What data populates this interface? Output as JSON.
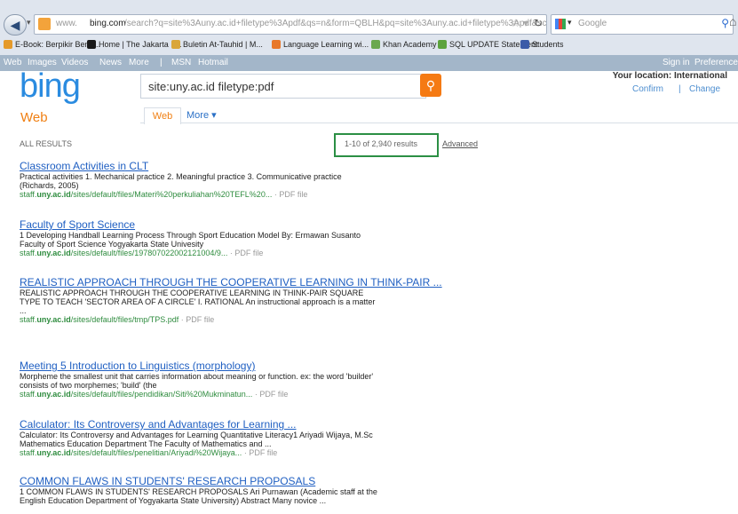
{
  "browser": {
    "url_prefix": "www.",
    "url_host": "bing.com",
    "url_path": "/search?q=site%3Auny.ac.id+filetype%3Apdf&qs=n&form=QBLH&pq=site%3Auny.ac.id+filetype%3Apdf&sc=0-",
    "search_engine_placeholder": "Google",
    "bookmarks": [
      {
        "label": "E-Book: Berpikir Bena...",
        "color": "#e59a2b"
      },
      {
        "label": "Home | The Jakarta P...",
        "color": "#1a1a1a"
      },
      {
        "label": "Buletin At-Tauhid | M...",
        "color": "#d9a63a"
      },
      {
        "label": "Language Learning wi...",
        "color": "#e8782a"
      },
      {
        "label": "Khan Academy",
        "color": "#6aa84f"
      },
      {
        "label": "SQL UPDATE Statement",
        "color": "#5ca33d"
      },
      {
        "label": "Students",
        "color": "#3b5ba8"
      }
    ]
  },
  "bing": {
    "nav_links": [
      "Web",
      "Images",
      "Videos",
      "News",
      "More",
      "|",
      "MSN",
      "Hotmail"
    ],
    "account_links": [
      "Sign in",
      "Preferences"
    ],
    "logo": "bing",
    "section_label": "Web",
    "search_query": "site:uny.ac.id filetype:pdf",
    "tabs": {
      "web": "Web",
      "more": "More ▾"
    },
    "location": "Your location: International",
    "confirm": "Confirm",
    "location_separator": "|",
    "change": "Change",
    "all_results": "ALL RESULTS",
    "result_count": "1-10 of 2,940 results",
    "advanced": "Advanced"
  },
  "results": [
    {
      "title": "Classroom Activities in CLT",
      "snippet": [
        "Practical activities 1. Mechanical practice 2. Meaningful practice 3. Communicative practice",
        "(Richards, 2005)"
      ],
      "url_pre": "staff.",
      "url_bold": "uny.ac.id",
      "url_rest": "/sites/default/files/Materi%20perkuliahan%20TEFL%20...",
      "filetype": "· PDF file"
    },
    {
      "title": "Faculty of Sport Science",
      "snippet": [
        "1 Developing Handball Learning Process Through Sport Education Model By: Ermawan Susanto",
        "Faculty of Sport Science Yogyakarta State Univesity"
      ],
      "url_pre": "staff.",
      "url_bold": "uny.ac.id",
      "url_rest": "/sites/default/files/197807022002121004/9...",
      "filetype": "· PDF file"
    },
    {
      "title": "REALISTIC APPROACH THROUGH THE COOPERATIVE LEARNING IN THINK-PAIR ...",
      "snippet": [
        "REALISTIC APPROACH THROUGH THE COOPERATIVE LEARNING IN THINK-PAIR SQUARE",
        "TYPE TO TEACH 'SECTOR AREA OF A CIRCLE' I. RATIONAL An instructional approach is a matter",
        "..."
      ],
      "url_pre": "staff.",
      "url_bold": "uny.ac.id",
      "url_rest": "/sites/default/files/tmp/TPS.pdf",
      "filetype": "· PDF file"
    },
    {
      "title": "Meeting 5 Introduction to Linguistics (morphology)",
      "snippet": [
        "Morpheme the smallest unit that carries information about meaning or function. ex: the word 'builder'",
        "consists of two morphemes; 'build' (the"
      ],
      "url_pre": "staff.",
      "url_bold": "uny.ac.id",
      "url_rest": "/sites/default/files/pendidikan/Siti%20Mukminatun...",
      "filetype": "· PDF file"
    },
    {
      "title": "Calculator: Its Controversy and Advantages for Learning ...",
      "snippet": [
        "Calculator: Its Controversy and Advantages for Learning Quantitative Literacy1 Ariyadi Wijaya, M.Sc",
        "Mathematics Education Department The Faculty of Mathematics and ..."
      ],
      "url_pre": "staff.",
      "url_bold": "uny.ac.id",
      "url_rest": "/sites/default/files/penelitian/Ariyadi%20Wijaya...",
      "filetype": "· PDF file"
    },
    {
      "title": "COMMON FLAWS IN STUDENTS' RESEARCH PROPOSALS",
      "snippet": [
        "1 COMMON FLAWS IN STUDENTS' RESEARCH PROPOSALS Ari Purnawan (Academic staff at the",
        "English Education Department of Yogyakarta State University) Abstract Many novice ..."
      ],
      "url_pre": "",
      "url_bold": "",
      "url_rest": "",
      "filetype": ""
    }
  ]
}
